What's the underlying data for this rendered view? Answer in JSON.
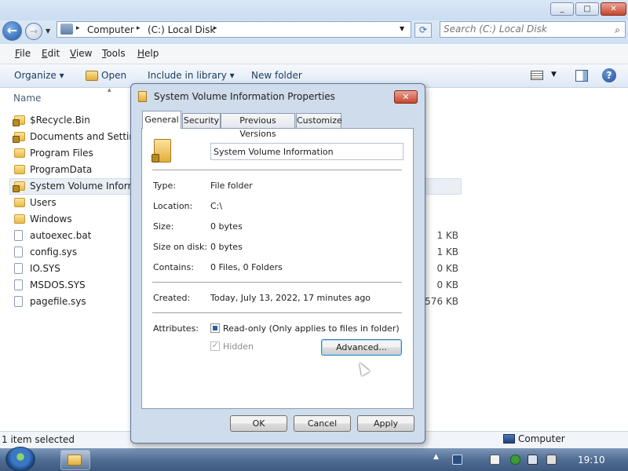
{
  "window": {
    "min": "_",
    "max": "□",
    "close": "✕"
  },
  "address": {
    "crumbs": [
      "Computer",
      "(C:) Local Disk"
    ],
    "separator": "▸",
    "search_placeholder": "Search (C:) Local Disk"
  },
  "menu": [
    "File",
    "Edit",
    "View",
    "Tools",
    "Help"
  ],
  "toolbar": {
    "organize": "Organize ▾",
    "open": "Open",
    "include": "Include in library ▾",
    "new_folder": "New folder"
  },
  "filelist": {
    "column_name": "Name",
    "items": [
      {
        "name": "$Recycle.Bin",
        "type": "lockfolder",
        "size": ""
      },
      {
        "name": "Documents and Settings",
        "type": "lockfolder",
        "size": ""
      },
      {
        "name": "Program Files",
        "type": "folder",
        "size": ""
      },
      {
        "name": "ProgramData",
        "type": "folder",
        "size": ""
      },
      {
        "name": "System Volume Informa",
        "type": "lockfolder",
        "size": ""
      },
      {
        "name": "Users",
        "type": "folder",
        "size": ""
      },
      {
        "name": "Windows",
        "type": "folder",
        "size": ""
      },
      {
        "name": "autoexec.bat",
        "type": "file",
        "size": "1 KB"
      },
      {
        "name": "config.sys",
        "type": "file",
        "size": "1 KB"
      },
      {
        "name": "IO.SYS",
        "type": "file",
        "size": "0 KB"
      },
      {
        "name": "MSDOS.SYS",
        "type": "file",
        "size": "0 KB"
      },
      {
        "name": "pagefile.sys",
        "type": "file",
        "size": ",576 KB"
      }
    ]
  },
  "status": {
    "selected": "1 item selected",
    "location": "Computer"
  },
  "taskbar": {
    "clock": "19:10"
  },
  "dialog": {
    "title": "System Volume Information Properties",
    "close": "✕",
    "tabs": [
      "General",
      "Security",
      "Previous Versions",
      "Customize"
    ],
    "name_value": "System Volume Information",
    "properties": [
      {
        "label": "Type:",
        "value": "File folder"
      },
      {
        "label": "Location:",
        "value": "C:\\"
      },
      {
        "label": "Size:",
        "value": "0 bytes"
      },
      {
        "label": "Size on disk:",
        "value": "0 bytes"
      },
      {
        "label": "Contains:",
        "value": "0 Files, 0 Folders"
      }
    ],
    "created_label": "Created:",
    "created_value": "Today, July 13, 2022, 17 minutes ago",
    "attributes_label": "Attributes:",
    "readonly_label": "Read-only (Only applies to files in folder)",
    "hidden_label": "Hidden",
    "advanced": "Advanced...",
    "ok": "OK",
    "cancel": "Cancel",
    "apply": "Apply"
  }
}
